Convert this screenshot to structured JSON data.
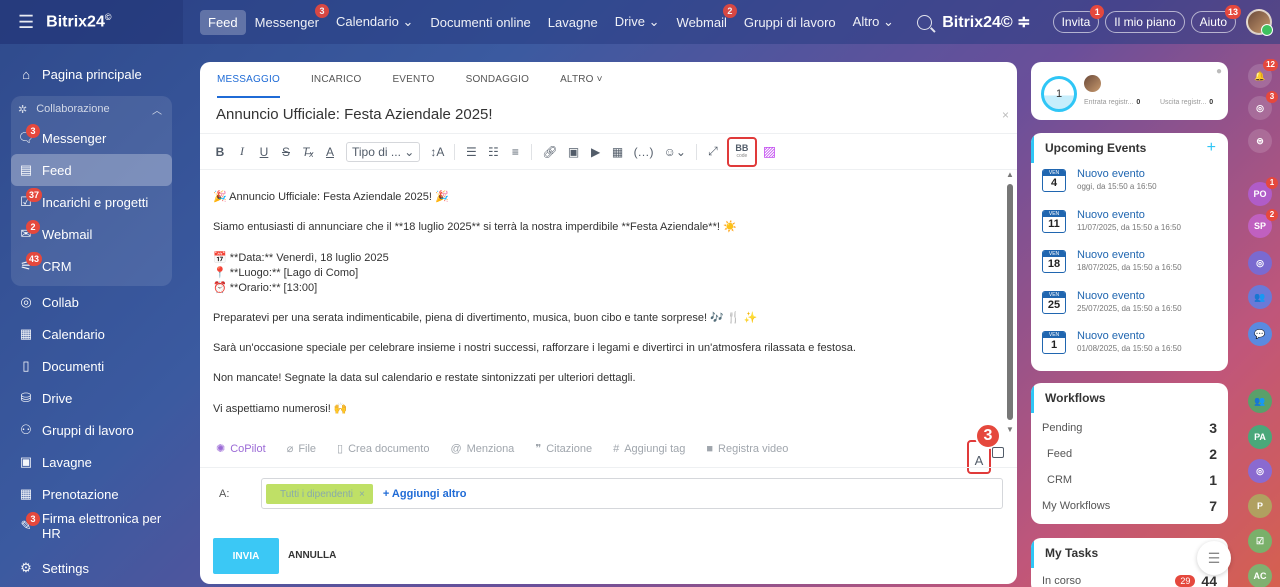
{
  "topbar": {
    "logo": "Bitrix24",
    "logo_mark": "©",
    "nav": [
      {
        "label": "Feed",
        "badge": ""
      },
      {
        "label": "Messenger",
        "badge": "3"
      },
      {
        "label": "Calendario ⌄",
        "badge": ""
      },
      {
        "label": "Documenti online",
        "badge": ""
      },
      {
        "label": "Lavagne",
        "badge": ""
      },
      {
        "label": "Drive ⌄",
        "badge": ""
      },
      {
        "label": "Webmail",
        "badge": "2"
      },
      {
        "label": "Gruppi di lavoro",
        "badge": ""
      },
      {
        "label": "Altro ⌄",
        "badge": ""
      }
    ],
    "brand_right": "Bitrix24© ≑",
    "invite": {
      "label": "Invita",
      "badge": "1"
    },
    "plan": "Il mio piano",
    "help": {
      "label": "Aiuto",
      "badge": "13"
    }
  },
  "sidebar": {
    "home": "Pagina principale",
    "group_title": "Collaborazione",
    "group_items": [
      {
        "label": "Messenger",
        "icon": "💬",
        "badge": "3"
      },
      {
        "label": "Feed",
        "icon": "▤",
        "badge": ""
      },
      {
        "label": "Incarichi e progetti",
        "icon": "☑",
        "badge": "37"
      },
      {
        "label": "Webmail",
        "icon": "✉",
        "badge": "2"
      },
      {
        "label": "CRM",
        "icon": "⚟",
        "badge": "43"
      }
    ],
    "items": [
      {
        "label": "Collab",
        "icon": "◎",
        "badge": ""
      },
      {
        "label": "Calendario",
        "icon": "▦",
        "badge": ""
      },
      {
        "label": "Documenti",
        "icon": "▯",
        "badge": ""
      },
      {
        "label": "Drive",
        "icon": "⛁",
        "badge": ""
      },
      {
        "label": "Gruppi di lavoro",
        "icon": "⚇",
        "badge": ""
      },
      {
        "label": "Lavagne",
        "icon": "▣",
        "badge": ""
      },
      {
        "label": "Prenotazione",
        "icon": "▦",
        "badge": ""
      },
      {
        "label": "Firma elettronica per HR",
        "icon": "✎",
        "badge": "3"
      }
    ],
    "settings": "Settings"
  },
  "editor": {
    "tabs": [
      "MESSAGGIO",
      "INCARICO",
      "EVENTO",
      "SONDAGGIO",
      "ALTRO ˅"
    ],
    "title": "Annuncio Ufficiale: Festa Aziendale 2025!",
    "font_select": "Tipo di ...",
    "bb_label": "BB",
    "bb_sub": "code",
    "body": {
      "p1": "🎉 Annuncio Ufficiale: Festa Aziendale 2025! 🎉",
      "p2": "Siamo entusiasti di annunciare che il **18 luglio 2025** si terrà la nostra imperdibile **Festa Aziendale**! ☀️",
      "l1": "📅 **Data:** Venerdì, 18 luglio 2025",
      "l2": "📍 **Luogo:** [Lago di Como]",
      "l3": "⏰ **Orario:** [13:00]",
      "p4": "Preparatevi per una serata indimenticabile, piena di divertimento, musica, buon cibo e tante sorprese! 🎶 🍴 ✨",
      "p5": "Sarà un'occasione speciale per celebrare insieme i nostri successi, rafforzare i legami e divertirci in un'atmosfera rilassata e festosa.",
      "p6": "Non mancate! Segnate la data sul calendario e restate sintonizzati per ulteriori dettagli.",
      "p7": "Vi aspettiamo numerosi! 🙌"
    },
    "actions": [
      "CoPilot",
      "File",
      "Crea documento",
      "Menziona",
      "Citazione",
      "Aggiungi tag",
      "Registra video"
    ],
    "format_btn": "A",
    "step_number": "3",
    "to_label": "A:",
    "recipient": "Tutti i dipendenti",
    "add_more": "+ Aggiungi altro",
    "send": "INVIA",
    "cancel": "ANNULLA"
  },
  "timeman": {
    "count": "1",
    "in_label": "Entrata registr...",
    "in_val": "0",
    "out_label": "Uscita registr...",
    "out_val": "0"
  },
  "events": {
    "title": "Upcoming Events",
    "day_label": "VEN",
    "items": [
      {
        "day": "4",
        "title": "Nuovo evento",
        "time": "oggi, da 15:50 a 16:50"
      },
      {
        "day": "11",
        "title": "Nuovo evento",
        "time": "11/07/2025, da 15:50 a 16:50"
      },
      {
        "day": "18",
        "title": "Nuovo evento",
        "time": "18/07/2025, da 15:50 a 16:50"
      },
      {
        "day": "25",
        "title": "Nuovo evento",
        "time": "25/07/2025, da 15:50 a 16:50"
      },
      {
        "day": "1",
        "title": "Nuovo evento",
        "time": "01/08/2025, da 15:50 a 16:50"
      }
    ]
  },
  "workflows": {
    "title": "Workflows",
    "rows": [
      {
        "label": "Pending",
        "value": "3"
      },
      {
        "label": "Feed",
        "value": "2"
      },
      {
        "label": "CRM",
        "value": "1"
      },
      {
        "label": "My Workflows",
        "value": "7"
      }
    ]
  },
  "tasks": {
    "title": "My Tasks",
    "row_label": "In corso",
    "badge": "29",
    "count": "44"
  },
  "rail": [
    {
      "text": "🔔",
      "badge": "12",
      "color": "rgba(255,255,255,.15)"
    },
    {
      "text": "◎",
      "badge": "3",
      "color": "rgba(255,255,255,.15)"
    },
    {
      "text": "⊜",
      "badge": "",
      "color": "rgba(255,255,255,.15)"
    },
    {
      "text": "PO",
      "badge": "1",
      "color": "#b05cc8"
    },
    {
      "text": "SP",
      "badge": "2",
      "color": "#c060c0"
    },
    {
      "text": "◎",
      "badge": "",
      "color": "#7a6ad0"
    },
    {
      "text": "👥",
      "badge": "",
      "color": "#6a7ad8"
    },
    {
      "text": "💬",
      "badge": "",
      "color": "#5a8ae0"
    },
    {
      "text": "👥",
      "badge": "",
      "color": "#5aa06a"
    },
    {
      "text": "PA",
      "badge": "",
      "color": "#4aa87a"
    },
    {
      "text": "◎",
      "badge": "",
      "color": "#8a6ad0"
    },
    {
      "text": "P",
      "badge": "",
      "color": "#b0a060"
    },
    {
      "text": "☑",
      "badge": "",
      "color": "#7ab06a"
    },
    {
      "text": "AC",
      "badge": "",
      "color": "#80b070"
    }
  ]
}
